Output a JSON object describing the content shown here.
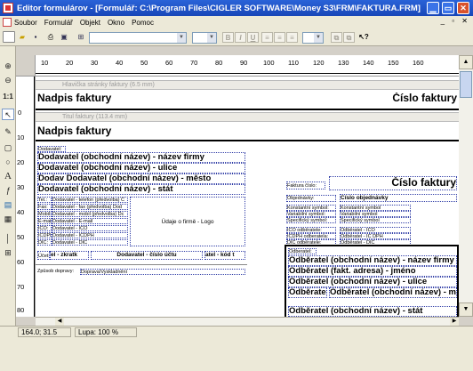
{
  "window": {
    "title": "Editor formulárov - [Formulář: C:\\Program Files\\CIGLER SOFTWARE\\Money S3\\FRM\\FAKTURA.FRM]"
  },
  "menu": {
    "items": [
      "Soubor",
      "Formulář",
      "Objekt",
      "Okno",
      "Pomoc"
    ]
  },
  "toolbar": {
    "format_buttons": [
      "B",
      "I",
      "U"
    ]
  },
  "ruler": {
    "h": [
      "10",
      "20",
      "30",
      "40",
      "50",
      "60",
      "70",
      "80",
      "90",
      "100",
      "110",
      "120",
      "130",
      "140",
      "150",
      "160"
    ],
    "v": [
      "0",
      "10",
      "20",
      "30",
      "40",
      "50",
      "60",
      "70",
      "80"
    ]
  },
  "bands": {
    "header": "Hlavička stránky faktury (6.5 mm)",
    "title": "Titul faktury (113.4 mm)"
  },
  "form": {
    "h_nadpis": "Nadpis faktury",
    "h_cislo": "Číslo faktury",
    "t_nadpis": "Nadpis faktury",
    "dodavatel_lbl": "Dodavatel:",
    "dod1": "Dodavatel (obchodní název) - název firmy",
    "dod2": "Dodavatel (obchodní název) - ulice",
    "dod3": "Dodav Dodavatel (obchodní název) - město",
    "dod4": "Dodavatel (obchodní název) - stát",
    "tel_l": "Tel.:",
    "tel_v": "Dodavatel - telefon (předvolba) C",
    "fax_l": "Fax:",
    "fax_v": "Dodavatel - fax (předvolba) Dod",
    "mob_l": "Mobil:",
    "mob_v": "Dodavatel - mobil (předvolba) Dc",
    "mail_l": "E-mail:",
    "mail_v": "Dodavatel - E-mail",
    "ico_l": "IČO:",
    "ico_v": "Dodavatel - IČO",
    "icdph_l": "IČDPH:",
    "icdph_v": "Dodavatel - IČDPH",
    "dic_l": "DIČ:",
    "dic_v": "Dodavatel - DIČ",
    "logo": "Údaje o firmě - Logo",
    "ucet_l": "Účet:",
    "ucet1": "el - zkratk",
    "ucet2": "Dodavatel - číslo účtu",
    "ucet3": "atel - kód t",
    "doprava_l": "Způsob dopravy:",
    "doprava_v": "Doprava/Vyskladnění",
    "fak_cislo_l": "Faktura číslo:",
    "fak_cislo_v": "Číslo faktury",
    "obj_l": "Objednávky:",
    "obj_v": "Číslo objednávky",
    "ks_l": "Konstantní symbol:",
    "ks_v": "Konstantní symbol",
    "vs_l": "Variabilní symbol:",
    "vs_v": "Variabilní symbol",
    "ss_l": "Specifický symbol:",
    "ss_v": "Specifický symbol",
    "oico_l": "IČO odběratele:",
    "oico_v": "Odběratel - IČO",
    "oicdph_l": "IČDPH odberatela:",
    "oicdph_v": "Odběratel - IČ DPH",
    "odic_l": "DIČ odběratele:",
    "odic_v": "Odběratel - DIČ",
    "odb_l": "Odberatel:",
    "odb1": "Odběratel (obchodní název) - název firmy",
    "odb2": "Odběratel (fakt. adresa) - jméno",
    "odb3": "Odběratel (obchodní název) - ulice",
    "odb4a": "Odběrate",
    "odb4b": "Odběratel (obchodní název) - mě",
    "odb5": "Odběratel (obchodní název) - stát"
  },
  "status": {
    "coords": "164.0; 31.5",
    "zoom": "Lupa: 100 %"
  }
}
